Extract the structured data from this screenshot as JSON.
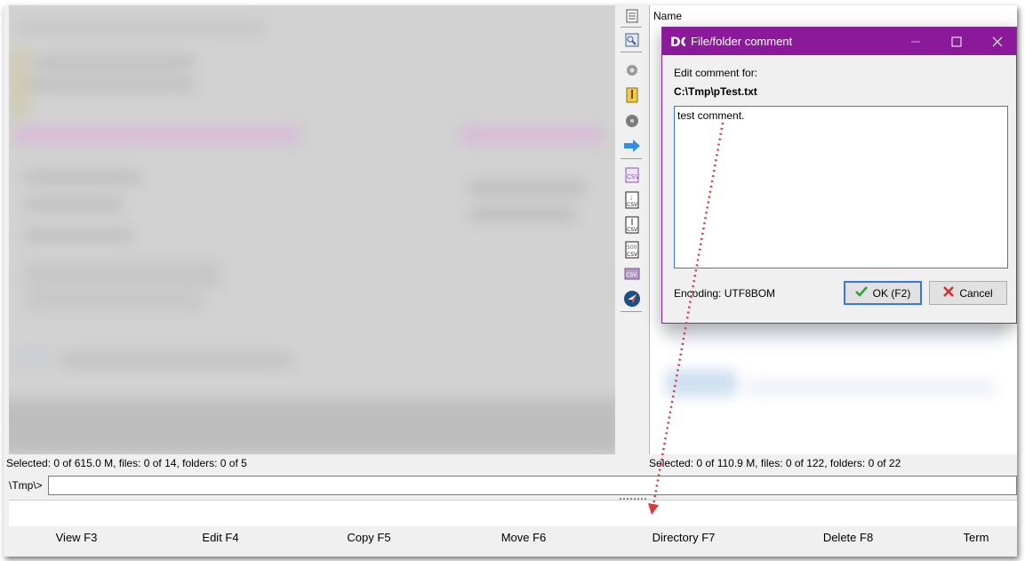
{
  "left_panel": {
    "status": "Selected: 0 of 615.0 M, files: 0 of 14, folders: 0 of 5"
  },
  "right_panel": {
    "column_name": "Name",
    "status": "Selected: 0 of 110.9 M, files: 0 of 122, folders: 0 of 22"
  },
  "command_line": {
    "path": "\\Tmp\\>",
    "value": ""
  },
  "function_keys": [
    {
      "label": "View F3"
    },
    {
      "label": "Edit F4"
    },
    {
      "label": "Copy F5"
    },
    {
      "label": "Move F6"
    },
    {
      "label": "Directory F7"
    },
    {
      "label": "Delete F8"
    },
    {
      "label": "Term"
    }
  ],
  "dialog": {
    "title": "File/folder comment",
    "label": "Edit comment for:",
    "file_path": "C:\\Tmp\\pTest.txt",
    "comment": "test comment.",
    "encoding_label": "Encoding:",
    "encoding_value": "UTF8BOM",
    "ok_label": "OK (F2)",
    "cancel_label": "Cancel",
    "title_color": "#8b1a9a"
  },
  "toolbar_icons": [
    "document-icon",
    "image-viewer-icon",
    "gear-icon",
    "archive-icon",
    "disk-icon",
    "arrow-right-icon",
    "csv-icon",
    "csv-semicolon-icon",
    "csv-pipe-icon",
    "csv-500-icon",
    "csv-small-icon",
    "nav-icon"
  ]
}
